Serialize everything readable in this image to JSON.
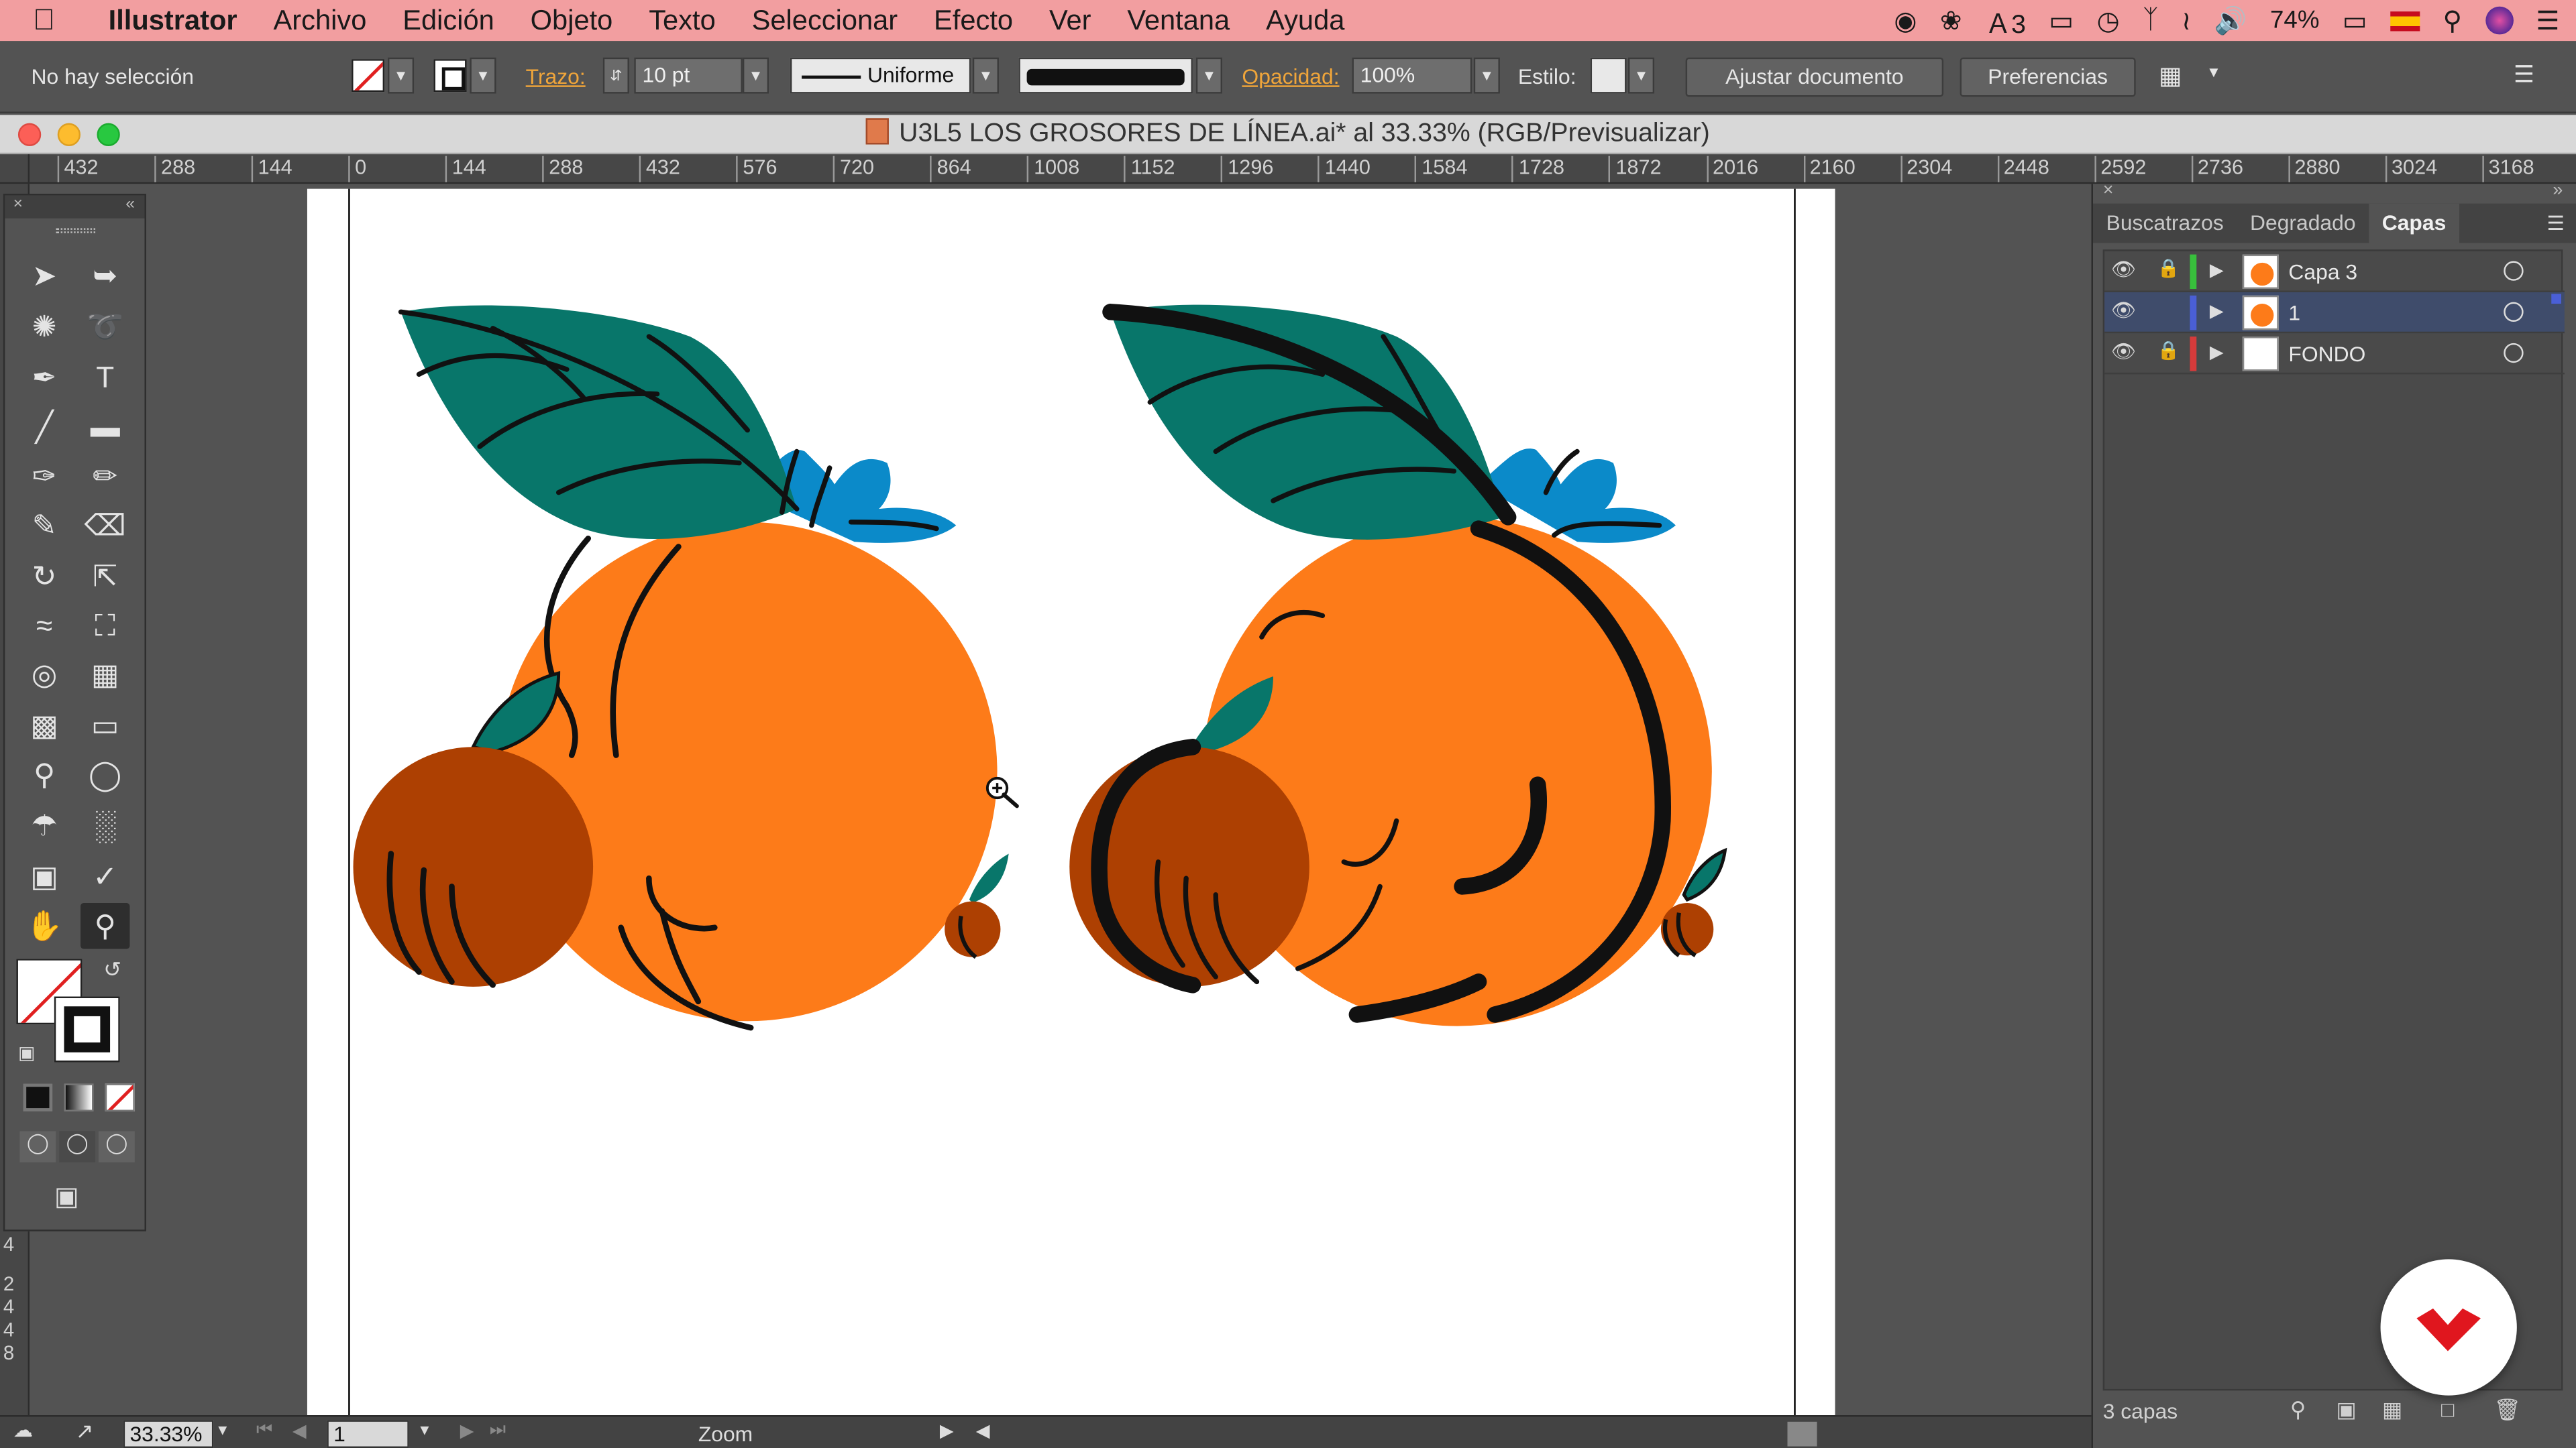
{
  "menubar": {
    "app_name": "Illustrator",
    "items": [
      "Archivo",
      "Edición",
      "Objeto",
      "Texto",
      "Seleccionar",
      "Efecto",
      "Ver",
      "Ventana",
      "Ayuda"
    ],
    "status": {
      "adobe_count": "3",
      "battery": "74%"
    },
    "icons": [
      "apple-icon",
      "record-icon",
      "creative-cloud-icon",
      "adobe-fonts-icon",
      "airplay-icon",
      "time-machine-icon",
      "bluetooth-icon",
      "wifi-icon",
      "volume-icon",
      "battery-icon",
      "flag-icon",
      "search-icon",
      "siri-icon",
      "list-icon"
    ]
  },
  "controlbar": {
    "selection_text": "No hay selección",
    "stroke_label": "Trazo:",
    "stroke_value": "10 pt",
    "profile_label": "Uniforme",
    "opacity_label": "Opacidad:",
    "opacity_value": "100%",
    "style_label": "Estilo:",
    "fit_button": "Ajustar documento",
    "prefs_button": "Preferencias",
    "accent_label_color": "#f0a53a"
  },
  "titlebar": {
    "title": "U3L5 LOS GROSORES DE LÍNEA.ai* al 33.33% (RGB/Previsualizar)"
  },
  "ruler": {
    "h_labels": [
      "432",
      "288",
      "144",
      "0",
      "144",
      "288",
      "432",
      "576",
      "720",
      "864",
      "1008",
      "1152",
      "1296",
      "1440",
      "1584",
      "1728",
      "1872",
      "2016",
      "2160",
      "2304",
      "2448",
      "2592",
      "2736",
      "2880",
      "3024",
      "3168"
    ],
    "v_labels": [
      "4",
      "2",
      "4",
      "4",
      "8"
    ]
  },
  "panel": {
    "tabs": [
      "Buscatrazos",
      "Degradado",
      "Capas"
    ],
    "active_tab": "Capas",
    "layers": [
      {
        "name": "Capa 3",
        "color": "#38c03c"
      },
      {
        "name": "1",
        "color": "#4a5fd6"
      },
      {
        "name": "FONDO",
        "color": "#d63b3b"
      }
    ],
    "footer": "3 capas"
  },
  "statusbar": {
    "zoom": "33.33%",
    "page": "1",
    "tool_name": "Zoom"
  },
  "colors": {
    "orange": "#fd7b19",
    "dark_orange": "#ad4002",
    "leaf_green": "#08766a",
    "blue": "#0b8ac9",
    "menubar_bg": "#f29ea0",
    "logo_red": "#e0161e"
  }
}
